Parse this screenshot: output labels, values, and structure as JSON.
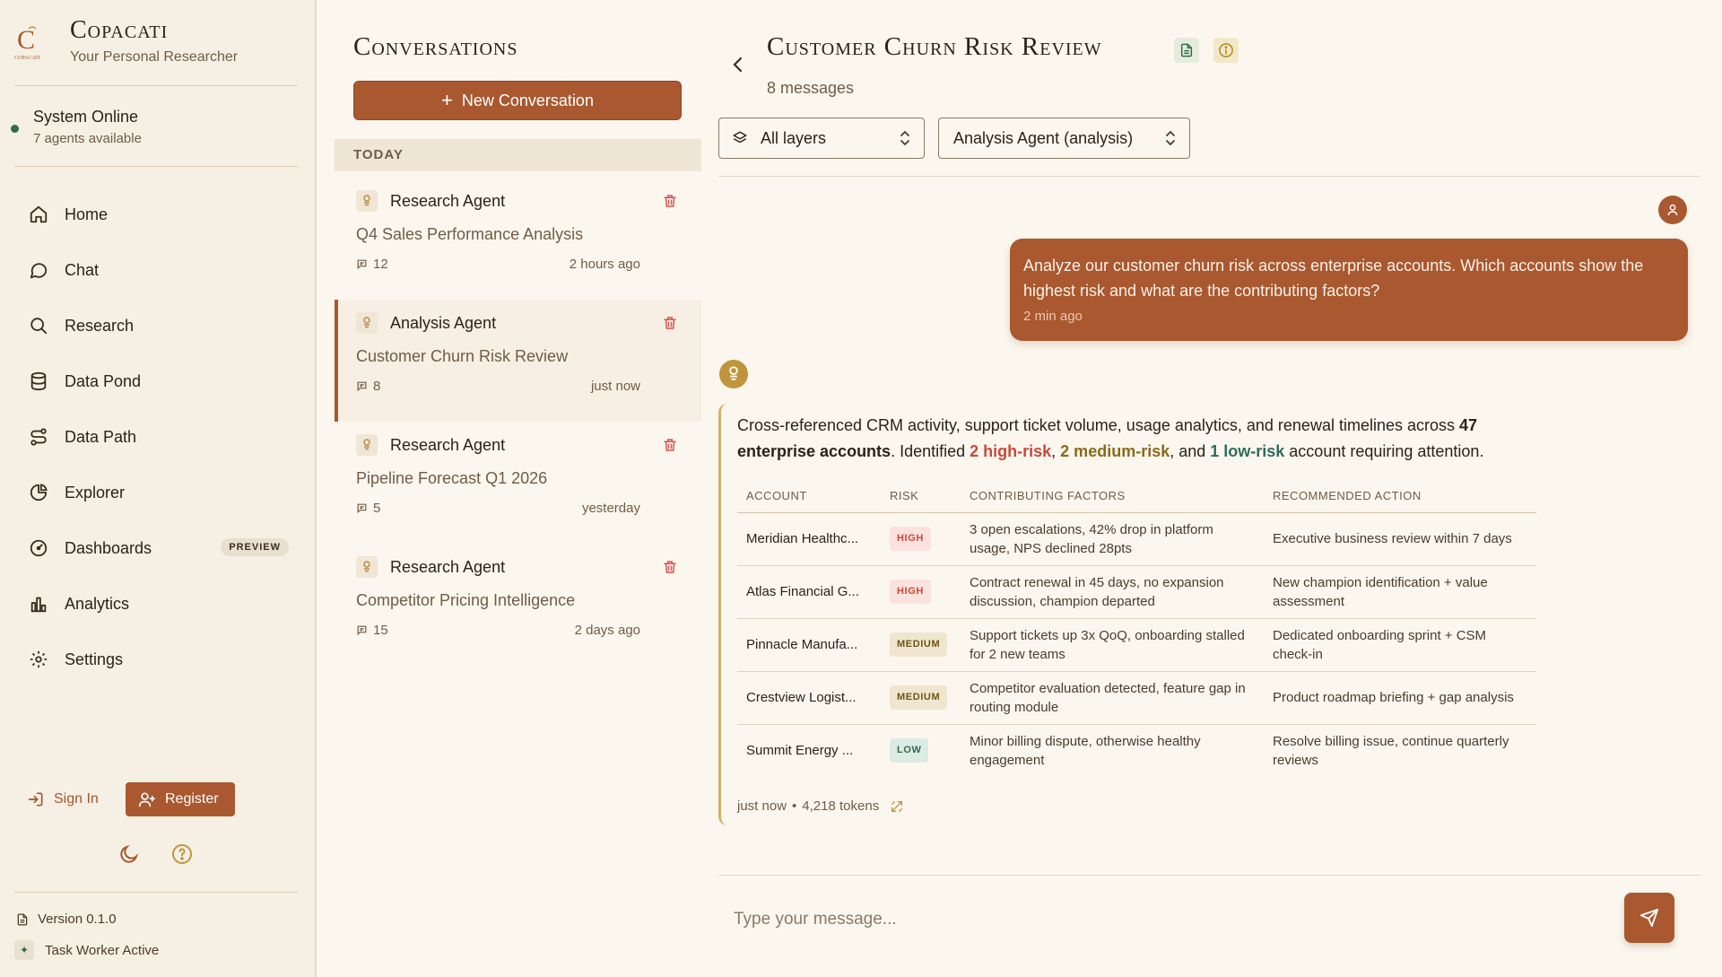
{
  "brand": {
    "name": "Copacati",
    "tagline": "Your Personal Researcher",
    "logo_text": "COPACATI"
  },
  "status": {
    "title": "System Online",
    "subtitle": "7 agents available",
    "color": "#2f6b4f"
  },
  "nav": [
    {
      "label": "Home",
      "icon": "home-icon"
    },
    {
      "label": "Chat",
      "icon": "chat-bubble-icon"
    },
    {
      "label": "Research",
      "icon": "search-icon"
    },
    {
      "label": "Data Pond",
      "icon": "database-icon"
    },
    {
      "label": "Data Path",
      "icon": "route-icon"
    },
    {
      "label": "Explorer",
      "icon": "pie-chart-icon"
    },
    {
      "label": "Dashboards",
      "icon": "gauge-icon",
      "badge": "PREVIEW"
    },
    {
      "label": "Analytics",
      "icon": "bar-chart-icon"
    },
    {
      "label": "Settings",
      "icon": "gear-icon"
    }
  ],
  "auth": {
    "sign_in": "Sign In",
    "register": "Register"
  },
  "footer": {
    "version": "Version 0.1.0",
    "worker": "Task Worker Active"
  },
  "conversations": {
    "title": "Conversations",
    "new_button": "New Conversation",
    "group_label": "TODAY",
    "items": [
      {
        "agent": "Research Agent",
        "title": "Q4 Sales Performance Analysis",
        "count": "12",
        "when": "2 hours ago",
        "active": false
      },
      {
        "agent": "Analysis Agent",
        "title": "Customer Churn Risk Review",
        "count": "8",
        "when": "just now",
        "active": true
      },
      {
        "agent": "Research Agent",
        "title": "Pipeline Forecast Q1 2026",
        "count": "5",
        "when": "yesterday",
        "active": false
      },
      {
        "agent": "Research Agent",
        "title": "Competitor Pricing Intelligence",
        "count": "15",
        "when": "2 days ago",
        "active": false
      }
    ]
  },
  "chat": {
    "title": "Customer Churn Risk Review",
    "message_count": "8 messages",
    "layer_select": "All layers",
    "agent_select": "Analysis Agent (analysis)",
    "user_message": {
      "text": "Analyze our customer churn risk across enterprise accounts. Which accounts show the highest risk and what are the contributing factors?",
      "time": "2 min ago"
    },
    "bot_message": {
      "summary_pre": "Cross-referenced CRM activity, support ticket volume, usage analytics, and renewal timelines across ",
      "summary_bold": "47 enterprise accounts",
      "summary_mid": ". Identified ",
      "high": "2 high-risk",
      "comma1": ", ",
      "medium": "2 medium-risk",
      "and": ", and ",
      "low": "1 low-risk",
      "summary_end": " account requiring attention.",
      "table": {
        "headers": [
          "ACCOUNT",
          "RISK",
          "CONTRIBUTING FACTORS",
          "RECOMMENDED ACTION"
        ],
        "rows": [
          {
            "account": "Meridian Healthc...",
            "risk": "HIGH",
            "level": "high",
            "factors": "3 open escalations, 42% drop in platform usage, NPS declined 28pts",
            "action": "Executive business review within 7 days"
          },
          {
            "account": "Atlas Financial G...",
            "risk": "HIGH",
            "level": "high",
            "factors": "Contract renewal in 45 days, no expansion discussion, champion departed",
            "action": "New champion identification + value assessment"
          },
          {
            "account": "Pinnacle Manufa...",
            "risk": "MEDIUM",
            "level": "medium",
            "factors": "Support tickets up 3x QoQ, onboarding stalled for 2 new teams",
            "action": "Dedicated onboarding sprint + CSM check-in"
          },
          {
            "account": "Crestview Logist...",
            "risk": "MEDIUM",
            "level": "medium",
            "factors": "Competitor evaluation detected, feature gap in routing module",
            "action": "Product roadmap briefing + gap analysis"
          },
          {
            "account": "Summit Energy ...",
            "risk": "LOW",
            "level": "low",
            "factors": "Minor billing dispute, otherwise healthy engagement",
            "action": "Resolve billing issue, continue quarterly reviews"
          }
        ]
      },
      "time": "just now",
      "tokens": "4,218 tokens"
    },
    "input_placeholder": "Type your message..."
  },
  "colors": {
    "accent": "#a9582f",
    "background": "#fbf7ef",
    "sidebar": "#f6f0e4",
    "gold": "#c0943a",
    "danger": "#d9534f"
  }
}
